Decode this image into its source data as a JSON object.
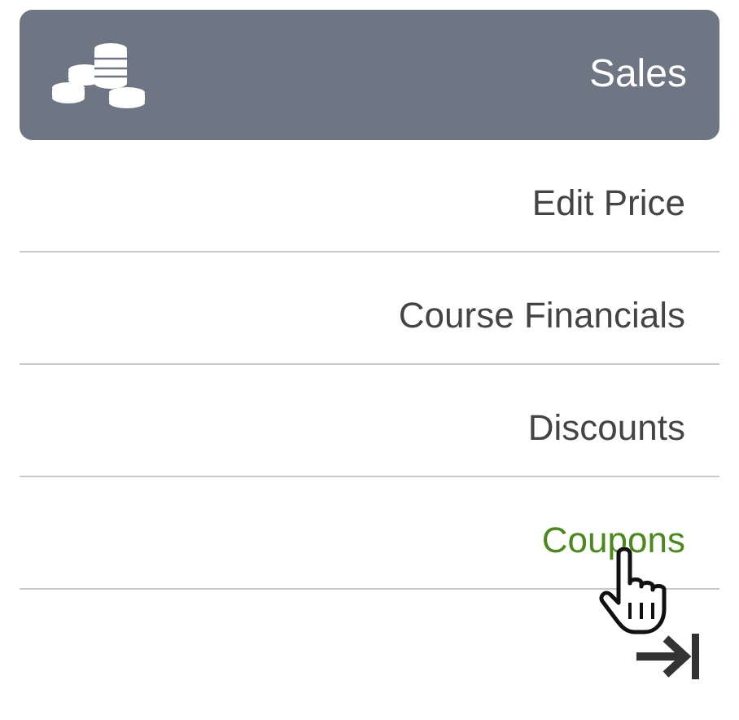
{
  "header": {
    "title": "Sales"
  },
  "menu_items": [
    {
      "label": "Edit Price",
      "selected": false
    },
    {
      "label": "Course Financials",
      "selected": false
    },
    {
      "label": "Discounts",
      "selected": false
    },
    {
      "label": "Coupons",
      "selected": true
    }
  ]
}
